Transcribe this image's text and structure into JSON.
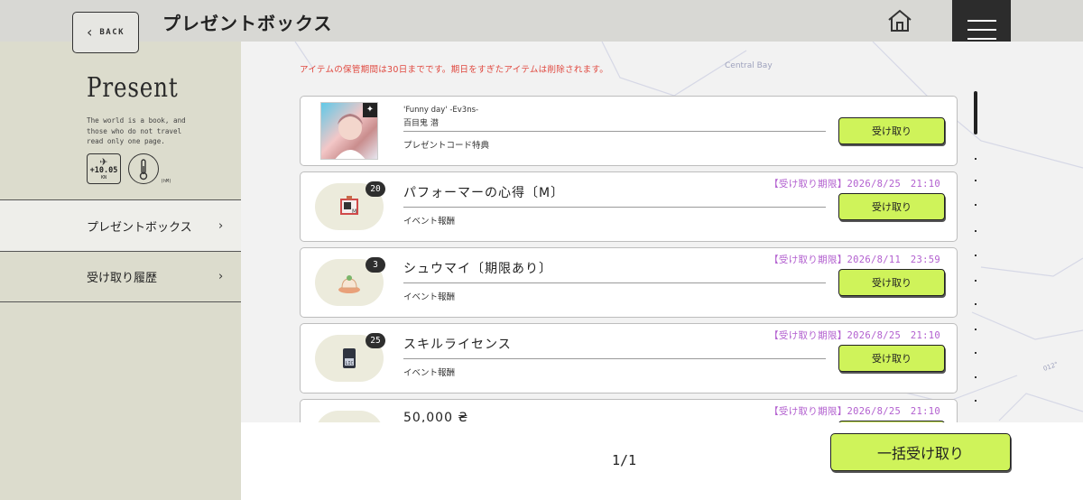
{
  "header": {
    "back_label": "BACK",
    "title": "プレゼントボックス",
    "home_icon": "home-icon",
    "menu_icon": "hamburger-menu-icon"
  },
  "sidebar": {
    "title": "Present",
    "description": "The world is a book, and\nthose who do not travel\nread only one page.",
    "plane_value": "+10.05",
    "plane_unit": "KN",
    "thermo_unit": "(hM)",
    "items": [
      {
        "label": "プレゼントボックス",
        "active": true
      },
      {
        "label": "受け取り履歴",
        "active": false
      }
    ]
  },
  "main": {
    "notice": "アイテムの保管期間は30日までです。期日をすぎたアイテムは削除されます。",
    "map_label": "Central Bay",
    "map_heading": "012°",
    "receive_label": "受け取り",
    "cards": [
      {
        "title": "'Funny day' -Ev3ns-",
        "name": "百目鬼 潜",
        "sub": "プレゼントコード特典",
        "deadline": "",
        "count": ""
      },
      {
        "name": "パフォーマーの心得〔M〕",
        "sub": "イベント報酬",
        "deadline": "【受け取り期限】2026/8/25　21:10",
        "count": "20"
      },
      {
        "name": "シュウマイ〔期限あり〕",
        "sub": "イベント報酬",
        "deadline": "【受け取り期限】2026/8/11　23:59",
        "count": "3"
      },
      {
        "name": "スキルライセンス",
        "sub": "イベント報酬",
        "deadline": "【受け取り期限】2026/8/25　21:10",
        "count": "25"
      },
      {
        "name": "50,000 ₴",
        "sub": "",
        "deadline": "【受け取り期限】2026/8/25　21:10",
        "count": ""
      }
    ]
  },
  "footer": {
    "pager": "1/1",
    "bulk_label": "一括受け取り"
  },
  "colors": {
    "accent_green": "#cff35a",
    "notice_red": "#e0483f",
    "deadline_purple": "#b25fcf"
  }
}
